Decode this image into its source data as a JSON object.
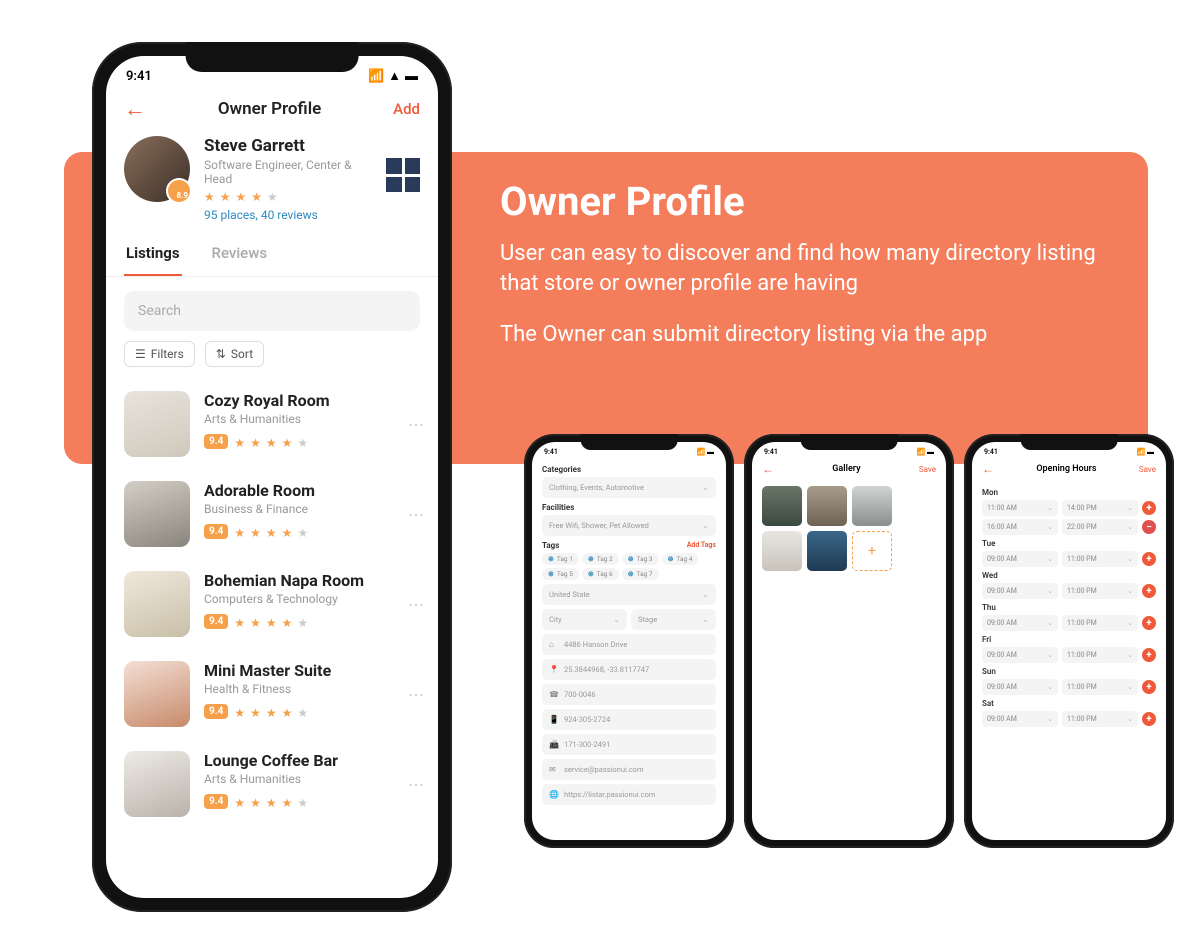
{
  "banner": {
    "title": "Owner Profile",
    "line1": "User can easy to discover and find how many directory listing that store or owner profile are having",
    "line2": "The Owner can submit directory listing via the app"
  },
  "mainPhone": {
    "statusTime": "9:41",
    "nav": {
      "title": "Owner Profile",
      "action": "Add"
    },
    "profile": {
      "name": "Steve Garrett",
      "role": "Software Engineer, Center & Head",
      "stats": "95 places, 40 reviews",
      "badge": "8.9"
    },
    "tabs": {
      "listings": "Listings",
      "reviews": "Reviews"
    },
    "search": {
      "placeholder": "Search"
    },
    "filters": {
      "filters": "Filters",
      "sort": "Sort"
    },
    "listings": [
      {
        "title": "Cozy Royal Room",
        "category": "Arts & Humanities",
        "score": "9.4"
      },
      {
        "title": "Adorable Room",
        "category": "Business & Finance",
        "score": "9.4"
      },
      {
        "title": "Bohemian Napa Room",
        "category": "Computers & Technology",
        "score": "9.4"
      },
      {
        "title": "Mini Master Suite",
        "category": "Health & Fitness",
        "score": "9.4"
      },
      {
        "title": "Lounge Coffee Bar",
        "category": "Arts & Humanities",
        "score": "9.4"
      }
    ]
  },
  "formPhone": {
    "statusTime": "9:41",
    "categoriesLabel": "Categories",
    "categoriesValue": "Clothing, Events, Automotive",
    "facilitiesLabel": "Facilities",
    "facilitiesValue": "Free Wifi, Shower, Pet Allowed",
    "tagsLabel": "Tags",
    "addTags": "Add Tags",
    "tags": [
      "Tag 1",
      "Tag 2",
      "Tag 3",
      "Tag 4",
      "Tag 5",
      "Tag 6",
      "Tag 7"
    ],
    "country": "United State",
    "city": "City",
    "stage": "Stage",
    "address": "4486 Hanson Drive",
    "coords": "25.3844968, -33.8117747",
    "phone1": "700-0046",
    "phone2": "924-305-2724",
    "phone3": "171-300-2491",
    "email": "service@passionui.com",
    "url": "https://listar.passionui.com"
  },
  "galleryPhone": {
    "statusTime": "9:41",
    "title": "Gallery",
    "action": "Save"
  },
  "hoursPhone": {
    "statusTime": "9:41",
    "title": "Opening Hours",
    "action": "Save",
    "days": [
      {
        "label": "Mon",
        "rows": [
          {
            "from": "11:00 AM",
            "to": "14:00 PM",
            "btn": "plus"
          },
          {
            "from": "16:00 AM",
            "to": "22:00 PM",
            "btn": "minus"
          }
        ]
      },
      {
        "label": "Tue",
        "rows": [
          {
            "from": "09:00 AM",
            "to": "11:00 PM",
            "btn": "plus"
          }
        ]
      },
      {
        "label": "Wed",
        "rows": [
          {
            "from": "09:00 AM",
            "to": "11:00 PM",
            "btn": "plus"
          }
        ]
      },
      {
        "label": "Thu",
        "rows": [
          {
            "from": "09:00 AM",
            "to": "11:00 PM",
            "btn": "plus"
          }
        ]
      },
      {
        "label": "Fri",
        "rows": [
          {
            "from": "09:00 AM",
            "to": "11:00 PM",
            "btn": "plus"
          }
        ]
      },
      {
        "label": "Sun",
        "rows": [
          {
            "from": "09:00 AM",
            "to": "11:00 PM",
            "btn": "plus"
          }
        ]
      },
      {
        "label": "Sat",
        "rows": [
          {
            "from": "09:00 AM",
            "to": "11:00 PM",
            "btn": "plus"
          }
        ]
      }
    ]
  }
}
